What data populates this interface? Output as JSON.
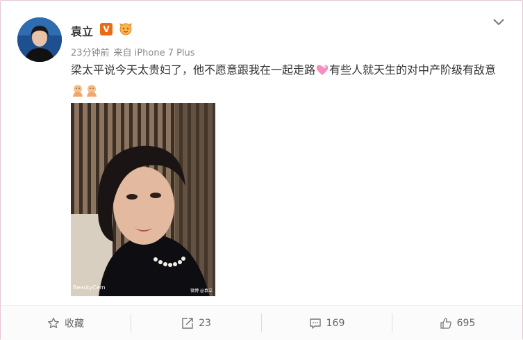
{
  "post": {
    "username": "袁立",
    "verified_badge": "V",
    "level_icon": "gold-level-icon",
    "time": "23分钟前",
    "source": "来自 iPhone 7 Plus",
    "text_part1": "梁太平说今天太贵妇了，他不愿意跟我在一起走路",
    "text_part2": "有些人就天生的对中产阶级有敌意",
    "photo_caption": "BeautyCam",
    "photo_watermark": "微博 @袁立"
  },
  "actions": {
    "favorite_label": "收藏",
    "repost_count": "23",
    "comment_count": "169",
    "like_count": "695"
  },
  "colors": {
    "badge": "#e96b14",
    "border": "#e6c6d6",
    "text": "#333333",
    "meta": "#888888"
  }
}
